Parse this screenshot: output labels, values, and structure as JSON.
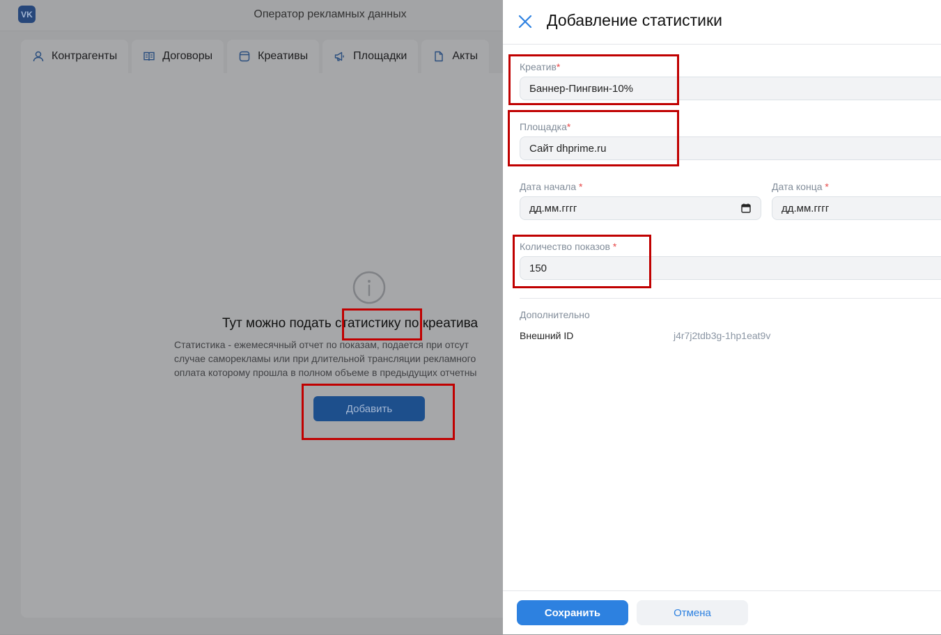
{
  "app": {
    "logo": "VK",
    "title": "Оператор рекламных данных",
    "tabs": [
      {
        "label": "Контрагенты",
        "icon": "user-icon"
      },
      {
        "label": "Договоры",
        "icon": "book-icon"
      },
      {
        "label": "Креативы",
        "icon": "creative-icon"
      },
      {
        "label": "Площадки",
        "icon": "megaphone-icon"
      },
      {
        "label": "Акты",
        "icon": "document-icon"
      }
    ],
    "empty_state": {
      "icon": "info-icon",
      "title": "Тут можно подать статистику по креатива",
      "title_highlight": "статистику",
      "text": "Статистика - ежемесячный отчет по показам, подается при отсут\nслучае саморекламы или при длительной трансляции рекламного\nоплата которому прошла в полном объеме в предыдущих отчетны",
      "add_button": "Добавить"
    }
  },
  "panel": {
    "title": "Добавление статистики",
    "close_icon": "close-icon",
    "fields": {
      "creative": {
        "label": "Креатив",
        "required_mark": "*",
        "value": "Баннер-Пингвин-10%"
      },
      "platform": {
        "label": "Площадка",
        "required_mark": "*",
        "value": "Сайт dhprime.ru"
      },
      "date_start": {
        "label": "Дата начала",
        "required_mark": "*",
        "placeholder": "дд.мм.гггг",
        "icon": "calendar-icon"
      },
      "date_end": {
        "label": "Дата конца",
        "required_mark": "*",
        "placeholder": "дд.мм.гггг"
      },
      "impressions": {
        "label": "Количество показов",
        "required_mark": "*",
        "value": "150"
      }
    },
    "additional": {
      "title": "Дополнительно",
      "external_id_label": "Внешний ID",
      "external_id_value": "j4r7j2tdb3g-1hp1eat9v"
    },
    "footer": {
      "save": "Сохранить",
      "cancel": "Отмена"
    }
  },
  "colors": {
    "primary": "#2d81e0",
    "highlight": "#c00000",
    "overlay_bg": "#a0a1a3"
  }
}
